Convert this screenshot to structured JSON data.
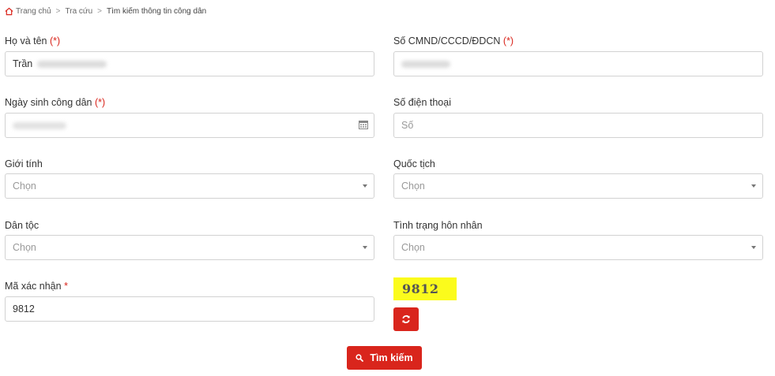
{
  "breadcrumb": {
    "home": "Trang chủ",
    "separator": ">",
    "lookup": "Tra cứu",
    "current": "Tìm kiếm thông tin công dân"
  },
  "form": {
    "full_name": {
      "label": "Họ và tên",
      "required": "(*)",
      "value_visible": "Trần"
    },
    "id_number": {
      "label": "Số CMND/CCCD/ĐDCN",
      "required": "(*)"
    },
    "birth_date": {
      "label": "Ngày sinh công dân",
      "required": "(*)"
    },
    "phone": {
      "label": "Số điện thoại",
      "placeholder": "Số"
    },
    "gender": {
      "label": "Giới tính",
      "selected": "Chọn"
    },
    "nationality": {
      "label": "Quốc tịch",
      "selected": "Chọn"
    },
    "ethnicity": {
      "label": "Dân tộc",
      "selected": "Chọn"
    },
    "marital_status": {
      "label": "Tình trạng hôn nhân",
      "selected": "Chọn"
    },
    "captcha": {
      "label": "Mã xác nhận",
      "required": "*",
      "value": "9812",
      "image_text": "9812"
    }
  },
  "actions": {
    "search_label": "Tìm kiếm"
  },
  "colors": {
    "accent": "#d9251c",
    "captcha_bg": "#fbfb1c",
    "border": "#d2d2d2"
  },
  "icons": {
    "home": "home-icon",
    "calendar": "calendar-icon",
    "refresh": "refresh-icon",
    "search": "search-icon"
  }
}
